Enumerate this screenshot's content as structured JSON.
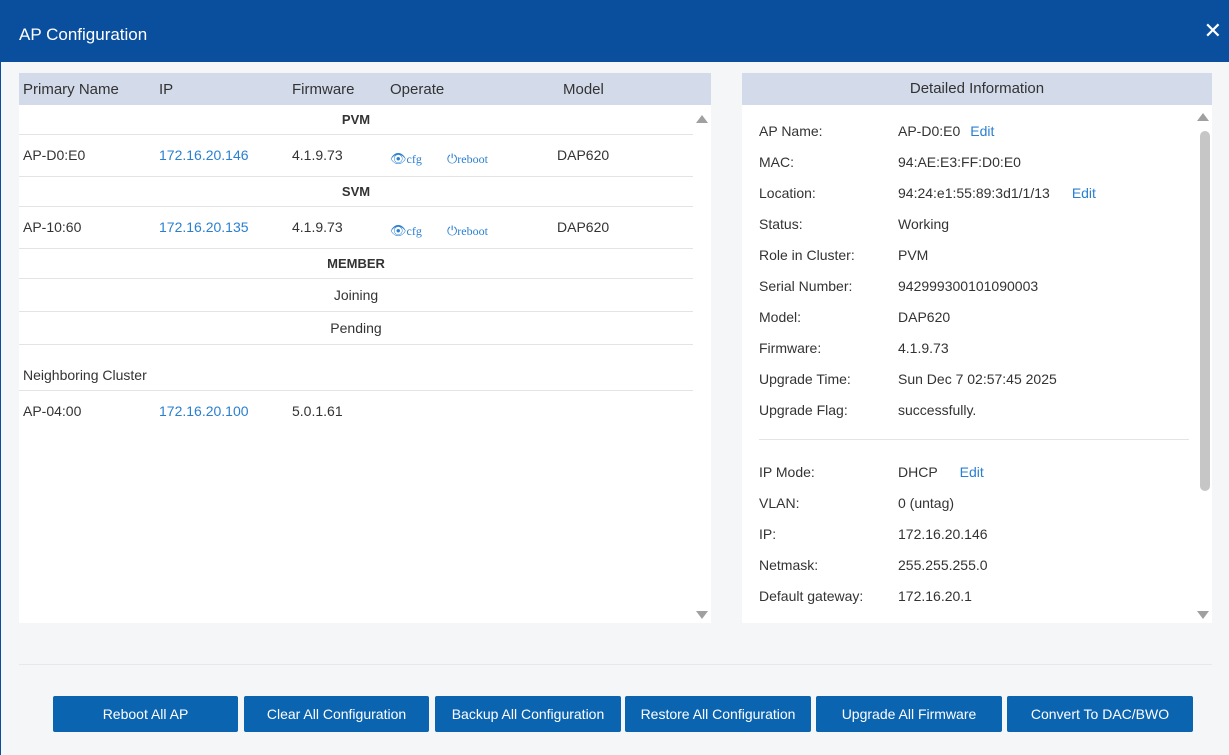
{
  "dialog": {
    "title": "AP Configuration"
  },
  "table": {
    "headers": [
      "Primary Name",
      "IP",
      "Firmware",
      "Operate",
      "Model"
    ],
    "groups": {
      "pvm": "PVM",
      "svm": "SVM",
      "member": "MEMBER"
    },
    "pvm_row": {
      "name": "AP-D0:E0",
      "ip": "172.16.20.146",
      "firmware": "4.1.9.73",
      "cfg": "cfg",
      "reboot": "reboot",
      "model": "DAP620"
    },
    "svm_row": {
      "name": "AP-10:60",
      "ip": "172.16.20.135",
      "firmware": "4.1.9.73",
      "cfg": "cfg",
      "reboot": "reboot",
      "model": "DAP620"
    },
    "member_status": [
      "Joining",
      "Pending"
    ],
    "neighboring_label": "Neighboring Cluster",
    "neighbor_row": {
      "name": "AP-04:00",
      "ip": "172.16.20.100",
      "firmware": "5.0.1.61"
    }
  },
  "details": {
    "header": "Detailed Information",
    "edit_label": "Edit",
    "ap_name": {
      "label": "AP Name:",
      "value": "AP-D0:E0"
    },
    "mac": {
      "label": "MAC:",
      "value": "94:AE:E3:FF:D0:E0"
    },
    "location": {
      "label": "Location:",
      "value": "94:24:e1:55:89:3d1/1/13"
    },
    "status": {
      "label": "Status:",
      "value": "Working"
    },
    "role": {
      "label": "Role in Cluster:",
      "value": "PVM"
    },
    "serial": {
      "label": "Serial Number:",
      "value": "942999300101090003"
    },
    "model": {
      "label": "Model:",
      "value": "DAP620"
    },
    "firmware": {
      "label": "Firmware:",
      "value": "4.1.9.73"
    },
    "upgrade_time": {
      "label": "Upgrade Time:",
      "value": "Sun Dec 7 02:57:45 2025"
    },
    "upgrade_flag": {
      "label": "Upgrade Flag:",
      "value": "successfully."
    },
    "ip_mode": {
      "label": "IP Mode:",
      "value": "DHCP"
    },
    "vlan": {
      "label": "VLAN:",
      "value": "0 (untag)"
    },
    "ip": {
      "label": "IP:",
      "value": "172.16.20.146"
    },
    "netmask": {
      "label": "Netmask:",
      "value": "255.255.255.0"
    },
    "gateway": {
      "label": "Default gateway:",
      "value": "172.16.20.1"
    }
  },
  "buttons": {
    "reboot_all": "Reboot All AP",
    "clear_all": "Clear All Configuration",
    "backup_all": "Backup All Configuration",
    "restore_all": "Restore All Configuration",
    "upgrade_all": "Upgrade All Firmware",
    "convert": "Convert To DAC/BWO"
  },
  "colors": {
    "title_bar": "#0a4f9e",
    "link": "#2a7fd1",
    "button": "#0a64b0",
    "table_header": "#d3dbea"
  },
  "icons": {
    "close": "close-icon",
    "cfg": "eye-icon",
    "reboot": "power-icon"
  }
}
